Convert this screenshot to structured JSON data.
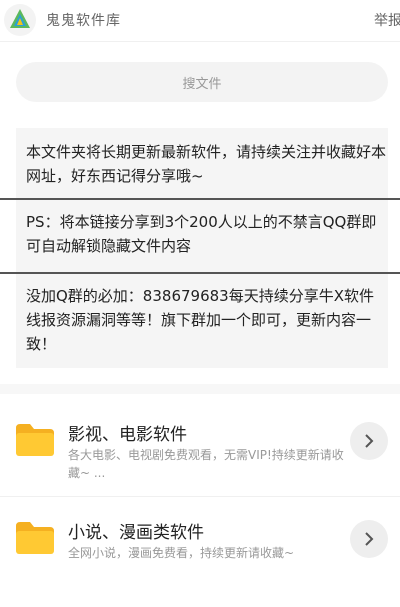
{
  "header": {
    "site_name": "鬼鬼软件库",
    "report_label": "举报"
  },
  "search": {
    "placeholder": "搜文件"
  },
  "notice": {
    "block1": "本文件夹将长期更新最新软件，请持续关注并收藏好本网址，好东西记得分享哦~",
    "block2": "PS：将本链接分享到3个200人以上的不禁言QQ群即可自动解锁隐藏文件内容",
    "block3": "没加Q群的必加：838679683每天持续分享牛X软件线报资源漏洞等等！旗下群加一个即可，更新内容一致！"
  },
  "folders": [
    {
      "title": "影视、电影软件",
      "description": "各大电影、电视剧免费观看，无需VIP!持续更新请收藏~ ..."
    },
    {
      "title": "小说、漫画类软件",
      "description": "全网小说，漫画免费看，持续更新请收藏~"
    }
  ],
  "colors": {
    "folder_yellow": "#FFC933",
    "folder_back": "#F5B021"
  }
}
